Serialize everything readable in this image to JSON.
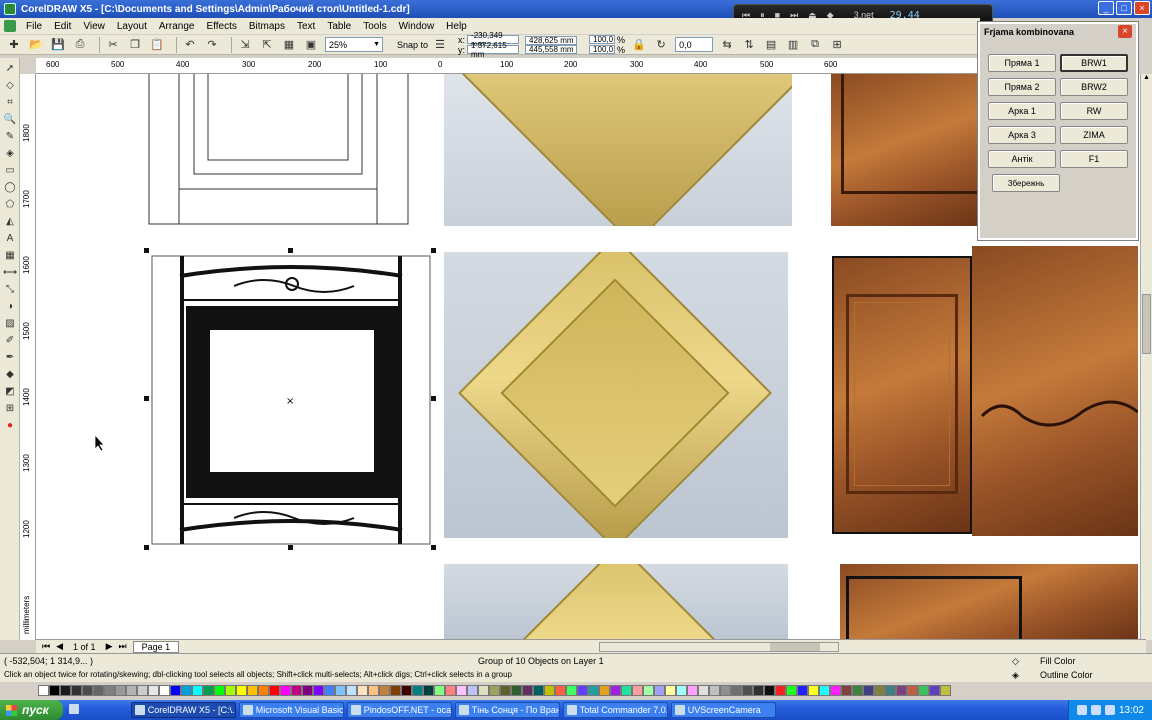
{
  "window": {
    "title": "CorelDRAW X5 - [C:\\Documents and Settings\\Admin\\Рабочий стол\\Untitled-1.cdr]"
  },
  "menu": {
    "items": [
      "File",
      "Edit",
      "View",
      "Layout",
      "Arrange",
      "Effects",
      "Bitmaps",
      "Text",
      "Table",
      "Tools",
      "Window",
      "Help"
    ]
  },
  "toolbar": {
    "zoom": "25%",
    "snap_to": "Snap to",
    "x": "-230,349 mm",
    "y": "1 372,615 mm",
    "width": "428,625 mm",
    "height": "445,558 mm",
    "scale_x": "100,0",
    "scale_y": "100,0",
    "pct_x": "%",
    "pct_y": "%",
    "angle": "0,0",
    "x_label": "x:",
    "y_label": "y:"
  },
  "media_player": {
    "site": "3.net",
    "time": "29.44"
  },
  "ruler": {
    "h": [
      "600",
      "500",
      "400",
      "300",
      "200",
      "100",
      "0",
      "100",
      "200",
      "300",
      "400",
      "500",
      "600"
    ],
    "v": [
      "1800",
      "1700",
      "1600",
      "1500",
      "1400",
      "1300",
      "1200"
    ],
    "units": "millimeters"
  },
  "panel": {
    "title": "Frjama kombinovana",
    "left_buttons": [
      "Пряма 1",
      "Пряма 2",
      "Арка 1",
      "Арка 3",
      "Антік"
    ],
    "right_buttons": [
      "BRW1",
      "BRW2",
      "RW",
      "ZIMA",
      "F1"
    ],
    "save": "Збережнь"
  },
  "doc_nav": {
    "page_count": "1 of 1",
    "page_tab": "Page 1"
  },
  "status": {
    "coords": "( -532,504; 1 314,9... )",
    "info": "Group of 10 Objects on Layer 1",
    "hint": "Click an object twice for rotating/skewing; dbl-clicking tool selects all objects; Shift+click multi-selects; Alt+click digs; Ctrl+click selects in a group",
    "fill": "Fill Color",
    "outline": "Outline Color"
  },
  "palette": [
    "#000000",
    "#1a1a1a",
    "#333333",
    "#4d4d4d",
    "#666666",
    "#808080",
    "#999999",
    "#b3b3b3",
    "#cccccc",
    "#e6e6e6",
    "#ffffff",
    "#0000ff",
    "#00a0e0",
    "#00ffff",
    "#00a050",
    "#00ff00",
    "#a0ff00",
    "#ffff00",
    "#ffc000",
    "#ff8000",
    "#ff0000",
    "#ff00ff",
    "#c00080",
    "#800080",
    "#8000ff",
    "#4080ff",
    "#80c0ff",
    "#c0e0ff",
    "#ffe0c0",
    "#ffc080",
    "#c08040",
    "#804000",
    "#400000",
    "#008080",
    "#004040",
    "#80ff80",
    "#ff8080",
    "#ffc0ff",
    "#c0c0ff",
    "#e0e0c0",
    "#a0a060",
    "#606030",
    "#306030",
    "#603060",
    "#006060",
    "#c0c000",
    "#ff6040",
    "#40ff60",
    "#6040ff",
    "#20a0a0",
    "#e0a020",
    "#a020e0",
    "#20e0a0",
    "#ffa0a0",
    "#a0ffa0",
    "#a0a0ff",
    "#ffffa0",
    "#a0ffff",
    "#ffa0ff",
    "#e0e0e0",
    "#c0c0c0",
    "#909090",
    "#707070",
    "#505050",
    "#303030",
    "#101010",
    "#ff2020",
    "#20ff20",
    "#2020ff",
    "#ffff20",
    "#20ffff",
    "#ff20ff",
    "#804040",
    "#408040",
    "#404080",
    "#808040",
    "#408080",
    "#804080",
    "#c06040",
    "#40c060",
    "#6040c0",
    "#c0c040"
  ],
  "taskbar": {
    "start": "пуск",
    "tasks": [
      "CorelDRAW X5 - [C:\\...",
      "Microsoft Visual Basic ...",
      "PindosOFF.NET - oca...",
      "Тінь Сонця - По Вран...",
      "Total Commander 7.0...",
      "UVScreenCamera"
    ],
    "clock": "13:02"
  }
}
